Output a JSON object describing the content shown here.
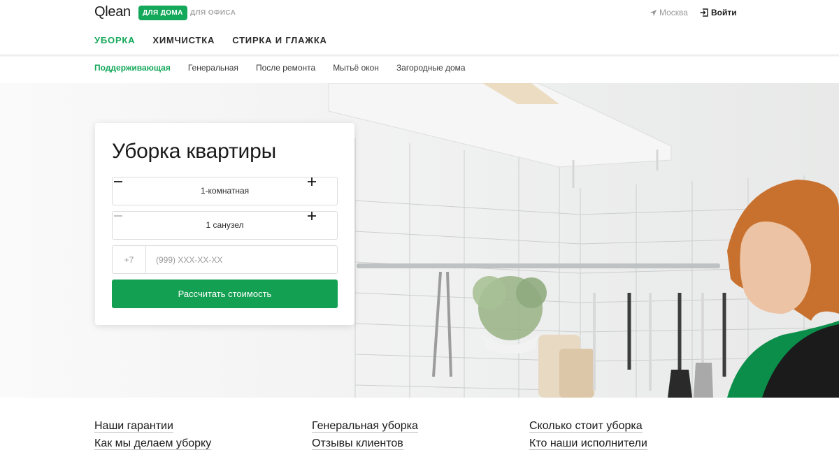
{
  "header": {
    "logo": "Qlean",
    "segments": {
      "home": "ДЛЯ ДОМА",
      "office": "ДЛЯ ОФИСА"
    },
    "city": "Москва",
    "login": "Войти",
    "nav": [
      "УБОРКА",
      "ХИМЧИСТКА",
      "СТИРКА И ГЛАЖКА"
    ],
    "nav_active": "УБОРКА"
  },
  "subnav": {
    "items": [
      "Поддерживающая",
      "Генеральная",
      "После ремонта",
      "Мытьё окон",
      "Загородные дома"
    ],
    "active": "Поддерживающая"
  },
  "form": {
    "title": "Уборка квартиры",
    "rooms": "1-комнатная",
    "bathrooms": "1 санузел",
    "phone_prefix": "+7",
    "phone_placeholder": "(999) XXX-XX-XX",
    "submit": "Рассчитать стоимость"
  },
  "footer_links": [
    "Наши гарантии",
    "Генеральная уборка",
    "Сколько стоит уборка",
    "Как мы делаем уборку",
    "Отзывы клиентов",
    "Кто наши исполнители"
  ],
  "colors": {
    "accent": "#14a85a",
    "button": "#14a053"
  },
  "icons": {
    "city": "location-arrow-icon",
    "login": "login-icon",
    "minus": "minus-icon",
    "plus": "plus-icon"
  }
}
